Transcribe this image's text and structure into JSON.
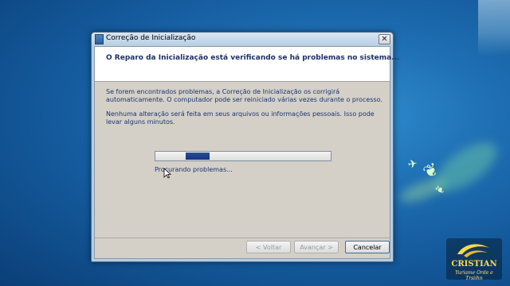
{
  "window": {
    "title": "Correção de Inicialização",
    "close_glyph": "✕",
    "header": "O Reparo da Inicialização está verificando se há problemas no sistema...",
    "paragraph1": "Se forem encontrados problemas, a Correção de Inicialização os corrigirá automaticamente. O computador pode ser reiniciado várias vezes durante o processo.",
    "paragraph2": "Nenhuma alteração será feita em seus arquivos ou informações pessoais. Isso pode levar alguns minutos.",
    "status": "Procurando problemas...",
    "progress_state": "indeterminate",
    "buttons": {
      "back": "< Voltar",
      "next": "Avançar >",
      "cancel": "Cancelar"
    }
  },
  "watermark": {
    "name": "CRISTIAN",
    "subtitle": "Yuriame Orde e Trsiihn"
  },
  "icons": {
    "title": "app-window-icon",
    "close": "close-icon",
    "cursor": "mouse-pointer-icon",
    "logo": "wave-logo-icon"
  },
  "colors": {
    "desktop": "#1f6fb4",
    "header_text": "#1e2f66",
    "body_text": "#1a3570",
    "progress_fill": "#16337a",
    "logo_text": "#ffd84a"
  }
}
